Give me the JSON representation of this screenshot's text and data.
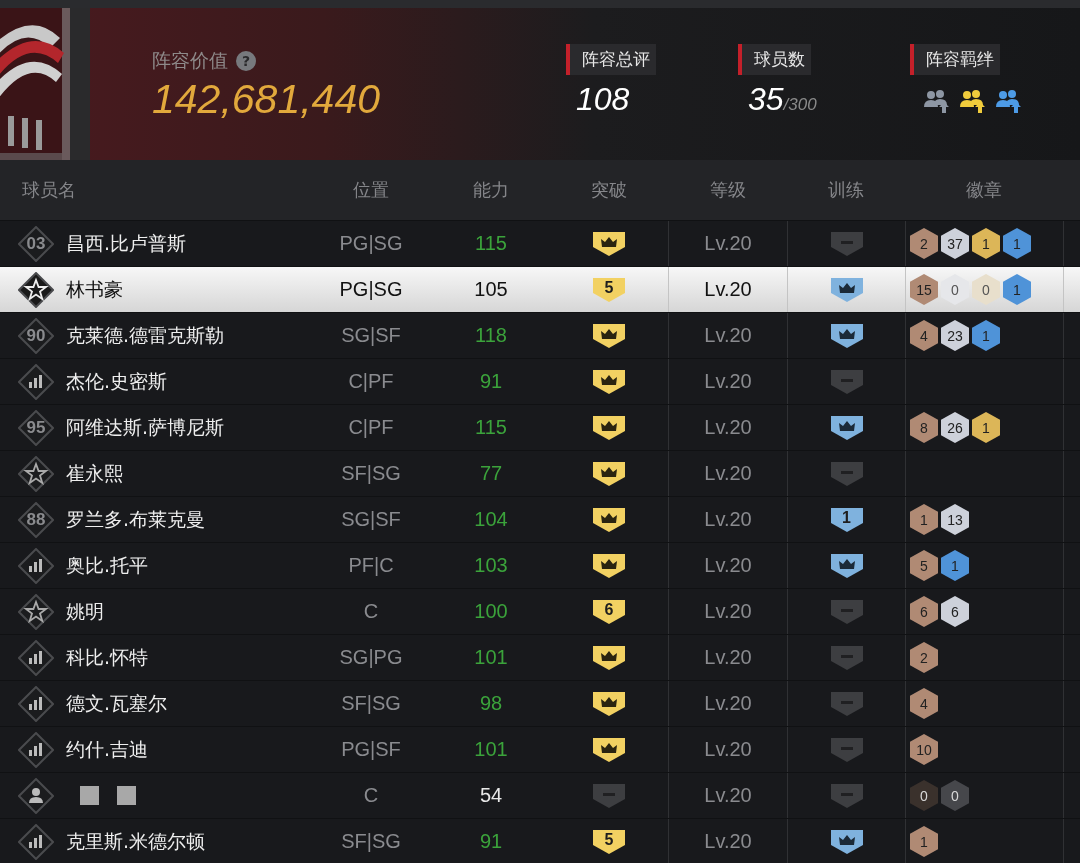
{
  "header": {
    "value_label": "阵容价值",
    "help_glyph": "?",
    "value": "142,681,440",
    "stats": [
      {
        "kind": "number",
        "label": "阵容总评",
        "value": "108"
      },
      {
        "kind": "ratio",
        "label": "球员数",
        "value": "35",
        "total": "/300"
      },
      {
        "kind": "bonds",
        "label": "阵容羁绊",
        "bonds": [
          {
            "color": "#8d96a3"
          },
          {
            "color": "#f0cc3c"
          },
          {
            "color": "#4d9be6"
          }
        ]
      }
    ]
  },
  "columns": [
    "球员名",
    "位置",
    "能力",
    "突破",
    "等级",
    "训练",
    "徽章"
  ],
  "rows": [
    {
      "tier": {
        "kind": "number",
        "text": "03"
      },
      "name": "昌西.比卢普斯",
      "position": "PG|SG",
      "rating": "115",
      "boosted": true,
      "selected": false,
      "breakthrough": {
        "kind": "crown"
      },
      "level": "Lv.20",
      "training": {
        "kind": "none"
      },
      "badges": [
        {
          "color": "#b08a74",
          "count": "2",
          "earned": true
        },
        {
          "color": "#cdd1da",
          "count": "37",
          "earned": true
        },
        {
          "color": "#dcb658",
          "count": "1",
          "earned": true
        },
        {
          "color": "#4f93d8",
          "count": "1",
          "earned": true
        }
      ]
    },
    {
      "tier": {
        "kind": "star"
      },
      "name": "林书豪",
      "position": "PG|SG",
      "rating": "105",
      "boosted": false,
      "selected": true,
      "breakthrough": {
        "kind": "number",
        "text": "5"
      },
      "level": "Lv.20",
      "training": {
        "kind": "crown"
      },
      "badges": [
        {
          "color": "#b08a74",
          "count": "15",
          "earned": true
        },
        {
          "color": "#e6e7ea",
          "count": "0",
          "earned": false
        },
        {
          "color": "#e8dfcc",
          "count": "0",
          "earned": false
        },
        {
          "color": "#4f93d8",
          "count": "1",
          "earned": true
        }
      ]
    },
    {
      "tier": {
        "kind": "number",
        "text": "90"
      },
      "name": "克莱德.德雷克斯勒",
      "position": "SG|SF",
      "rating": "118",
      "boosted": true,
      "selected": false,
      "breakthrough": {
        "kind": "crown"
      },
      "level": "Lv.20",
      "training": {
        "kind": "crown"
      },
      "badges": [
        {
          "color": "#b08a74",
          "count": "4",
          "earned": true
        },
        {
          "color": "#cdd1da",
          "count": "23",
          "earned": true
        },
        {
          "color": "#4f93d8",
          "count": "1",
          "earned": true
        }
      ]
    },
    {
      "tier": {
        "kind": "bars"
      },
      "name": "杰伦.史密斯",
      "position": "C|PF",
      "rating": "91",
      "boosted": true,
      "selected": false,
      "breakthrough": {
        "kind": "crown"
      },
      "level": "Lv.20",
      "training": {
        "kind": "none"
      }
    },
    {
      "tier": {
        "kind": "number",
        "text": "95"
      },
      "name": "阿维达斯.萨博尼斯",
      "position": "C|PF",
      "rating": "115",
      "boosted": true,
      "selected": false,
      "breakthrough": {
        "kind": "crown"
      },
      "level": "Lv.20",
      "training": {
        "kind": "crown"
      },
      "badges": [
        {
          "color": "#b08a74",
          "count": "8",
          "earned": true
        },
        {
          "color": "#cdd1da",
          "count": "26",
          "earned": true
        },
        {
          "color": "#dcb658",
          "count": "1",
          "earned": true
        }
      ]
    },
    {
      "tier": {
        "kind": "star"
      },
      "name": "崔永熙",
      "position": "SF|SG",
      "rating": "77",
      "boosted": true,
      "selected": false,
      "breakthrough": {
        "kind": "crown"
      },
      "level": "Lv.20",
      "training": {
        "kind": "none"
      }
    },
    {
      "tier": {
        "kind": "number",
        "text": "88"
      },
      "name": "罗兰多.布莱克曼",
      "position": "SG|SF",
      "rating": "104",
      "boosted": true,
      "selected": false,
      "breakthrough": {
        "kind": "crown"
      },
      "level": "Lv.20",
      "training": {
        "kind": "number",
        "text": "1"
      },
      "badges": [
        {
          "color": "#b08a74",
          "count": "1",
          "earned": true
        },
        {
          "color": "#cdd1da",
          "count": "13",
          "earned": true
        }
      ]
    },
    {
      "tier": {
        "kind": "bars"
      },
      "name": "奥比.托平",
      "position": "PF|C",
      "rating": "103",
      "boosted": true,
      "selected": false,
      "breakthrough": {
        "kind": "crown"
      },
      "level": "Lv.20",
      "training": {
        "kind": "crown"
      },
      "badges": [
        {
          "color": "#b08a74",
          "count": "5",
          "earned": true
        },
        {
          "color": "#4f93d8",
          "count": "1",
          "earned": true
        }
      ]
    },
    {
      "tier": {
        "kind": "star"
      },
      "name": "姚明",
      "position": "C",
      "rating": "100",
      "boosted": true,
      "selected": false,
      "breakthrough": {
        "kind": "number",
        "text": "6"
      },
      "level": "Lv.20",
      "training": {
        "kind": "none"
      },
      "badges": [
        {
          "color": "#b08a74",
          "count": "6",
          "earned": true
        },
        {
          "color": "#cdd1da",
          "count": "6",
          "earned": true
        }
      ]
    },
    {
      "tier": {
        "kind": "bars"
      },
      "name": "科比.怀特",
      "position": "SG|PG",
      "rating": "101",
      "boosted": true,
      "selected": false,
      "breakthrough": {
        "kind": "crown"
      },
      "level": "Lv.20",
      "training": {
        "kind": "none"
      },
      "badges": [
        {
          "color": "#b08a74",
          "count": "2",
          "earned": true
        }
      ]
    },
    {
      "tier": {
        "kind": "bars"
      },
      "name": "德文.瓦塞尔",
      "position": "SF|SG",
      "rating": "98",
      "boosted": true,
      "selected": false,
      "breakthrough": {
        "kind": "crown"
      },
      "level": "Lv.20",
      "training": {
        "kind": "none"
      },
      "badges": [
        {
          "color": "#b08a74",
          "count": "4",
          "earned": true
        }
      ]
    },
    {
      "tier": {
        "kind": "bars"
      },
      "name": "约什.吉迪",
      "position": "PG|SF",
      "rating": "101",
      "boosted": true,
      "selected": false,
      "breakthrough": {
        "kind": "crown"
      },
      "level": "Lv.20",
      "training": {
        "kind": "none"
      },
      "badges": [
        {
          "color": "#b08a74",
          "count": "10",
          "earned": true
        }
      ]
    },
    {
      "tier": {
        "kind": "person"
      },
      "name_hidden": true,
      "position": "C",
      "rating": "54",
      "boosted": false,
      "selected": false,
      "breakthrough": {
        "kind": "none"
      },
      "level": "Lv.20",
      "training": {
        "kind": "none"
      },
      "badges": [
        {
          "color": "#3a312c",
          "count": "0",
          "earned": false
        },
        {
          "color": "#46474b",
          "count": "0",
          "earned": false
        }
      ]
    },
    {
      "tier": {
        "kind": "bars"
      },
      "name": "克里斯.米德尔顿",
      "position": "SF|SG",
      "rating": "91",
      "boosted": true,
      "selected": false,
      "breakthrough": {
        "kind": "number",
        "text": "5"
      },
      "level": "Lv.20",
      "training": {
        "kind": "crown"
      },
      "badges": [
        {
          "color": "#b08a74",
          "count": "1",
          "earned": true
        }
      ]
    }
  ]
}
